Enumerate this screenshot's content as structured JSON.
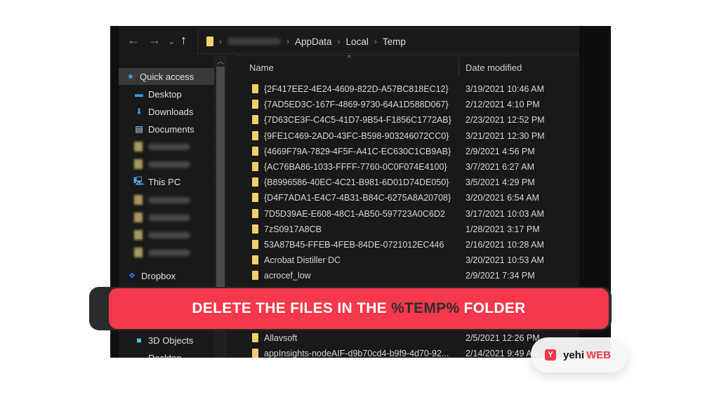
{
  "explorer": {
    "breadcrumb": [
      "(blurred user)",
      "AppData",
      "Local",
      "Temp"
    ],
    "nav": {
      "back": "←",
      "forward": "→",
      "recent": "⌄",
      "up": "↑"
    }
  },
  "sidebar": {
    "items": [
      {
        "label": "Quick access",
        "icon": "star-icon",
        "glyph": "★",
        "color": "#2f9bf0",
        "pinned": false,
        "selected": true
      },
      {
        "label": "Desktop",
        "icon": "desktop-icon",
        "glyph": "▬",
        "color": "#2f9bf0",
        "pinned": true
      },
      {
        "label": "Downloads",
        "icon": "download-icon",
        "glyph": "⬇",
        "color": "#2f9bf0",
        "pinned": true
      },
      {
        "label": "Documents",
        "icon": "document-icon",
        "glyph": "▤",
        "color": "#cfe3f5",
        "pinned": true
      },
      {
        "label": "",
        "icon": "folder-icon",
        "blurred": true,
        "pinned": true
      },
      {
        "label": "",
        "icon": "folder-icon",
        "blurred": true,
        "pinned": true
      },
      {
        "label": "This PC",
        "icon": "computer-icon",
        "glyph": "🖳",
        "color": "#5fb6f0",
        "pinned": true
      },
      {
        "label": "",
        "icon": "folder-icon",
        "blurred": true
      },
      {
        "label": "",
        "icon": "folder-icon",
        "blurred": true
      },
      {
        "label": "",
        "icon": "folder-icon",
        "blurred": true
      },
      {
        "label": "",
        "icon": "folder-icon",
        "blurred": true
      },
      {
        "label": "Dropbox",
        "icon": "dropbox-icon",
        "glyph": "❖",
        "color": "#1f6fe5"
      },
      {
        "label": "3D Objects",
        "icon": "cube-icon",
        "glyph": "■",
        "color": "#4fc3e8"
      },
      {
        "label": "Desktop",
        "icon": "desktop-icon",
        "glyph": "▬",
        "color": "#2f9bf0"
      }
    ],
    "pin_glyph": "📌"
  },
  "columns": {
    "name": "Name",
    "date": "Date modified",
    "sort_glyph": "^"
  },
  "files": [
    {
      "name": "{2F417EE2-4E24-4609-822D-A57BC818EC12}",
      "date": "3/19/2021 10:46 AM"
    },
    {
      "name": "{7AD5ED3C-167F-4869-9730-64A1D588D067}",
      "date": "2/12/2021 4:10 PM"
    },
    {
      "name": "{7D63CE3F-C4C5-41D7-9B54-F1856C1772AB}",
      "date": "2/23/2021 12:52 PM"
    },
    {
      "name": "{9FE1C469-2AD0-43FC-B598-903246072CC0}",
      "date": "3/21/2021 12:30 PM"
    },
    {
      "name": "{4669F79A-7829-4F5F-A41C-EC630C1CB9AB}",
      "date": "2/9/2021 4:56 PM"
    },
    {
      "name": "{AC76BA86-1033-FFFF-7760-0C0F074E4100}",
      "date": "3/7/2021 6:27 AM"
    },
    {
      "name": "{B8996586-40EC-4C21-B981-6D01D74DE050}",
      "date": "3/5/2021 4:29 PM"
    },
    {
      "name": "{D4F7ADA1-E4C7-4B31-B84C-6275A8A20708}",
      "date": "3/20/2021 6:54 AM"
    },
    {
      "name": "7D5D39AE-E608-48C1-AB50-597723A0C6D2",
      "date": "3/17/2021 10:03 AM"
    },
    {
      "name": "7zS0917A8CB",
      "date": "1/28/2021 3:17 PM"
    },
    {
      "name": "53A87B45-FFEB-4FEB-84DE-0721012EC446",
      "date": "2/16/2021 10:28 AM"
    },
    {
      "name": "Acrobat Distiller DC",
      "date": "3/20/2021 10:53 AM"
    },
    {
      "name": "acrocef_low",
      "date": "2/9/2021 7:34 PM"
    },
    {
      "name": "",
      "date": ""
    },
    {
      "name": "",
      "date": ""
    },
    {
      "name": "",
      "date": ""
    },
    {
      "name": "Allavsoft",
      "date": "2/5/2021 12:26 PM"
    },
    {
      "name": "appInsights-nodeAIF-d9b70cd4-b9f9-4d70-92...",
      "date": "2/14/2021 9:49 AM"
    }
  ],
  "banner": {
    "prefix": "DELETE THE FILES IN THE",
    "highlight": "%TEMP%",
    "suffix": "FOLDER"
  },
  "brand": {
    "logo_glyph": "Y",
    "name_part1": "yehi",
    "name_part2": "WEB",
    "accent": "#f5384b"
  }
}
